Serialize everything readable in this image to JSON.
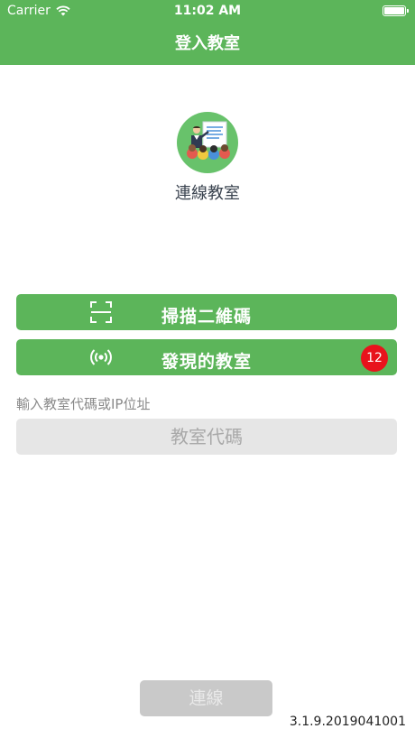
{
  "status_bar": {
    "carrier": "Carrier",
    "time": "11:02 AM",
    "wifi_icon": "wifi-icon",
    "battery_icon": "battery-icon"
  },
  "header": {
    "title": "登入教室",
    "background_color": "#5cb55a"
  },
  "app": {
    "name": "連線教室",
    "logo_icon": "classroom-teacher-students-icon"
  },
  "actions": {
    "scan": {
      "label": "掃描二維碼",
      "icon": "qr-scan-icon"
    },
    "discover": {
      "label": "發現的教室",
      "icon": "broadcast-icon",
      "badge": "12",
      "badge_color": "#e8131c"
    }
  },
  "code_entry": {
    "label": "輸入教室代碼或IP位址",
    "placeholder": "教室代碼",
    "value": ""
  },
  "connect": {
    "label": "連線"
  },
  "version": "3.1.9.2019041001",
  "colors": {
    "accent": "#5cb55a",
    "disabled": "#c9c9c9",
    "input_bg": "#e6e6e6"
  }
}
